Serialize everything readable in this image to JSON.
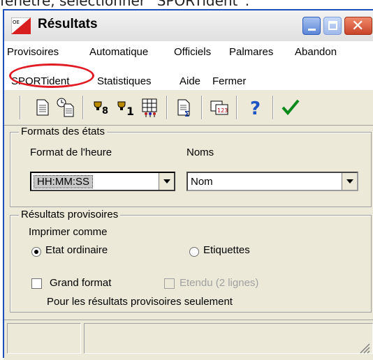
{
  "caption": "fenêtre, sélectionner “SPORTident”.",
  "window": {
    "title": "Résultats"
  },
  "menu": {
    "row1": [
      "Provisoires",
      "Automatique",
      "Officiels",
      "Palmares",
      "Abandon"
    ],
    "row2": [
      "SPORTident",
      "Statistiques",
      "Aide",
      "Fermer"
    ],
    "highlighted": "SPORTident"
  },
  "toolbar_icons": [
    "page-icon",
    "page-clock-icon",
    "trophy-8-icon",
    "trophy-1-icon",
    "grid-people-icon",
    "page-sum-icon",
    "numbers-icon",
    "help-icon",
    "check-icon"
  ],
  "formats": {
    "legend": "Formats des états",
    "time_label": "Format de l'heure",
    "time_value": "HH:MM:SS",
    "names_label": "Noms",
    "names_value": "Nom"
  },
  "provisional": {
    "legend": "Résultats provisoires",
    "print_as": "Imprimer comme",
    "radio_ordinary": "Etat ordinaire",
    "radio_labels": "Etiquettes",
    "selected_radio": "Etat ordinaire",
    "check_large": "Grand format",
    "check_extended": "Etendu (2 lignes)",
    "note": "Pour les résultats provisoires seulement"
  },
  "colors": {
    "highlight": "#e01b24",
    "accent": "#1b4fbf"
  }
}
